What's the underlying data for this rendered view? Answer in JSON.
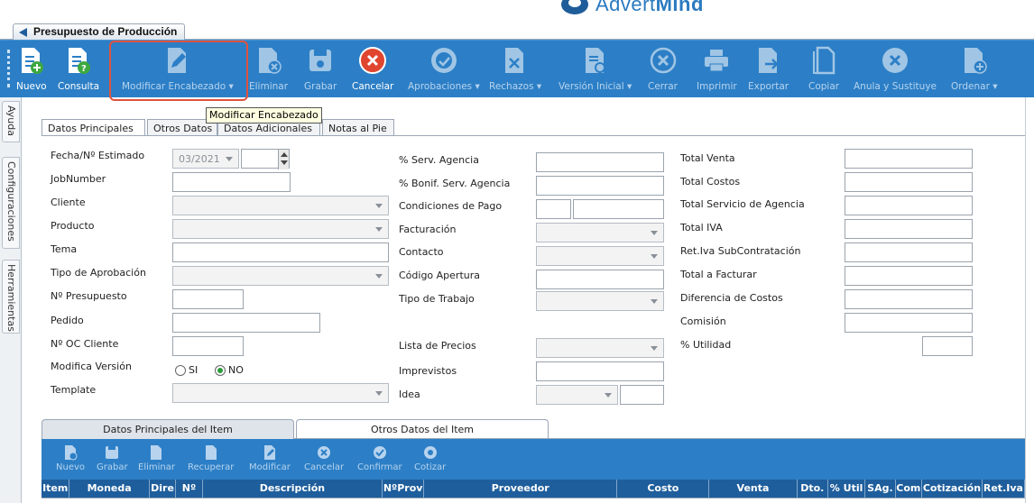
{
  "brand": {
    "name_prefix": "Advert",
    "name_suffix": "Mind"
  },
  "document_tab": {
    "label": "Presupuesto de Producción"
  },
  "toolbar": {
    "buttons": [
      {
        "label": "Nuevo"
      },
      {
        "label": "Consulta"
      },
      {
        "label": "Modificar Encabezado ▾"
      },
      {
        "label": "Eliminar"
      },
      {
        "label": "Grabar"
      },
      {
        "label": "Cancelar"
      },
      {
        "label": "Aprobaciones ▾"
      },
      {
        "label": "Rechazos ▾"
      },
      {
        "label": "Versión Inicial ▾"
      },
      {
        "label": "Cerrar"
      },
      {
        "label": "Imprimir"
      },
      {
        "label": "Exportar"
      },
      {
        "label": "Copiar"
      },
      {
        "label": "Anula y Sustituye"
      },
      {
        "label": "Ordenar ▾"
      }
    ],
    "tooltip": "Modificar Encabezado"
  },
  "side_tabs": [
    "Ayuda",
    "Configuraciones",
    "Herramientas"
  ],
  "form_tabs": [
    "Datos Principales",
    "Otros Datos",
    "Datos Adicionales",
    "Notas al Pie"
  ],
  "form": {
    "col1": {
      "fecha_label": "Fecha/Nº Estimado",
      "fecha_value": "03/2021",
      "jobnumber_label": "JobNumber",
      "cliente_label": "Cliente",
      "producto_label": "Producto",
      "tema_label": "Tema",
      "tipo_aprobacion_label": "Tipo de Aprobación",
      "presupuesto_label": "Nº Presupuesto",
      "pedido_label": "Pedido",
      "oc_cliente_label": "Nº OC Cliente",
      "modifica_version_label": "Modifica Versión",
      "si_label": "SI",
      "no_label": "NO",
      "template_label": "Template"
    },
    "col2": {
      "serv_agencia_label": "% Serv. Agencia",
      "bonif_label": "% Bonif. Serv. Agencia",
      "condiciones_label": "Condiciones de Pago",
      "facturacion_label": "Facturación",
      "contacto_label": "Contacto",
      "codigo_apertura_label": "Código Apertura",
      "tipo_trabajo_label": "Tipo de Trabajo",
      "lista_precios_label": "Lista de Precios",
      "imprevistos_label": "Imprevistos",
      "idea_label": "Idea"
    },
    "col3": {
      "total_venta_label": "Total Venta",
      "total_costos_label": "Total Costos",
      "total_servicio_label": "Total Servicio de Agencia",
      "total_iva_label": "Total IVA",
      "ret_iva_label": "Ret.Iva SubContratación",
      "total_facturar_label": "Total a Facturar",
      "diferencia_label": "Diferencia de Costos",
      "comision_label": "Comisión",
      "utilidad_label": "% Utilidad"
    }
  },
  "item_tabs": [
    "Datos Principales del Item",
    "Otros Datos del Item"
  ],
  "item_toolbar": [
    "Nuevo",
    "Grabar",
    "Eliminar",
    "Recuperar",
    "Modificar",
    "Cancelar",
    "Confirmar",
    "Cotizar"
  ],
  "grid_columns": [
    "Item",
    "Moneda",
    "Dire",
    "Nº",
    "Descripción",
    "NºProv",
    "Proveedor",
    "Costo",
    "Venta",
    "Dto.",
    "% Util",
    "SAg.",
    "Com",
    "Cotización",
    "Ret.Iva"
  ],
  "colors": {
    "toolbar_blue": "#2c7fc6",
    "grid_header": "#1f5e9c",
    "highlight": "#e0523f"
  }
}
